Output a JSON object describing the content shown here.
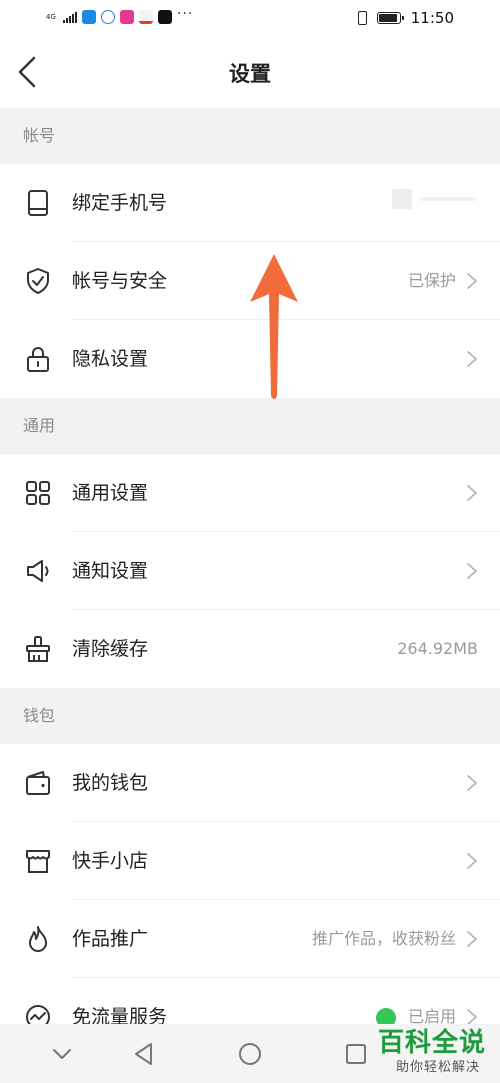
{
  "status_bar": {
    "network": "4G",
    "time": "11:50",
    "battery_level": 0.85,
    "more_indicator": "···"
  },
  "header": {
    "title": "设置",
    "back_icon": "chevron-left-icon"
  },
  "sections": [
    {
      "title": "帐号",
      "items": [
        {
          "label": "绑定手机号",
          "value": "",
          "icon": "phone-icon"
        },
        {
          "label": "帐号与安全",
          "value": "已保护",
          "icon": "shield-check-icon"
        },
        {
          "label": "隐私设置",
          "value": "",
          "icon": "lock-icon"
        }
      ]
    },
    {
      "title": "通用",
      "items": [
        {
          "label": "通用设置",
          "value": "",
          "icon": "grid-icon"
        },
        {
          "label": "通知设置",
          "value": "",
          "icon": "speaker-icon"
        },
        {
          "label": "清除缓存",
          "value": "264.92MB",
          "icon": "broom-icon"
        }
      ]
    },
    {
      "title": "钱包",
      "items": [
        {
          "label": "我的钱包",
          "value": "",
          "icon": "wallet-icon"
        },
        {
          "label": "快手小店",
          "value": "",
          "icon": "store-icon"
        },
        {
          "label": "作品推广",
          "value": "推广作品，收获粉丝",
          "icon": "flame-icon"
        },
        {
          "label": "免流量服务",
          "value": "已启用",
          "icon": "pulse-icon"
        }
      ]
    }
  ],
  "watermark": {
    "title": "百科全说",
    "subtitle": "助你轻松解决"
  },
  "colors": {
    "section_bg": "#f2f2f2",
    "arrow": "#f26b3a",
    "enabled_green": "#34c759",
    "watermark_green": "#1e9b3b"
  }
}
